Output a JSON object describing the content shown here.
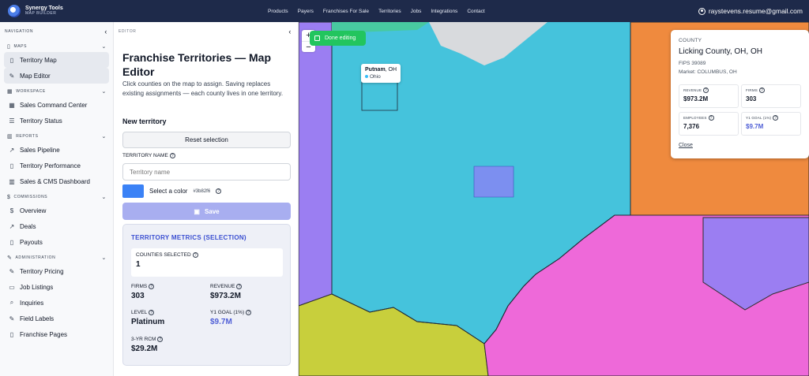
{
  "brand": {
    "name": "Synergy Tools",
    "sub": "MAP BUILDER"
  },
  "topnav": [
    "Products",
    "Payers",
    "Franchises For Sale",
    "Territories",
    "Jobs",
    "Integrations",
    "Contact"
  ],
  "user": {
    "email": "raystevens.resume@gmail.com"
  },
  "sidebar": {
    "header": "NAVIGATION",
    "sections": [
      {
        "title": "MAPS",
        "items": [
          "Territory Map",
          "Map Editor"
        ]
      },
      {
        "title": "WORKSPACE",
        "items": [
          "Sales Command Center",
          "Territory Status"
        ]
      },
      {
        "title": "REPORTS",
        "items": [
          "Sales Pipeline",
          "Territory Performance",
          "Sales & CMS Dashboard"
        ]
      },
      {
        "title": "COMMISSIONS",
        "items": [
          "Overview",
          "Deals",
          "Payouts"
        ]
      },
      {
        "title": "ADMINISTRATION",
        "items": [
          "Territory Pricing",
          "Job Listings",
          "Inquiries",
          "Field Labels",
          "Franchise Pages"
        ]
      }
    ]
  },
  "editor": {
    "header": "EDITOR",
    "title": "Franchise Territories — Map Editor",
    "description": "Click counties on the map to assign. Saving replaces existing assignments — each county lives in one territory.",
    "new_territory": "New territory",
    "reset_label": "Reset selection",
    "name_label": "TERRITORY NAME",
    "name_placeholder": "Territory name",
    "color_label": "Select a color",
    "color_hex": "#3b82f6",
    "save_label": "Save"
  },
  "metrics": {
    "title": "TERRITORY METRICS (SELECTION)",
    "counties_label": "COUNTIES SELECTED",
    "counties_value": "1",
    "firms_label": "FIRMS",
    "firms_value": "303",
    "revenue_label": "REVENUE",
    "revenue_value": "$973.2M",
    "level_label": "LEVEL",
    "level_value": "Platinum",
    "goal_label": "Y1 GOAL (1%)",
    "goal_value": "$9.7M",
    "rcm_label": "3-YR RCM",
    "rcm_value": "$29.2M"
  },
  "map": {
    "done_label": "Done editing",
    "tooltip": {
      "county": "Putnam",
      "state_suffix": ", OH",
      "state": "Ohio"
    },
    "info": {
      "kicker": "COUNTY",
      "name": "Licking County, OH, OH",
      "fips": "FIPS 39089",
      "market": "Market: COLUMBUS, OH",
      "revenue_label": "REVENUE",
      "revenue_value": "$973.2M",
      "firms_label": "FIRMS",
      "firms_value": "303",
      "employees_label": "EMPLOYEES",
      "employees_value": "7,376",
      "goal_label": "Y1 GOAL (1%)",
      "goal_value": "$9.7M",
      "close_label": "Close"
    },
    "colors": {
      "ohio": "#45c3dc",
      "pennsylvania": "#ef8a3e",
      "indiana": "#9b7ef2",
      "kentucky": "#c8cf3c",
      "west_virginia": "#ee69d9",
      "selected": "#7c8ff0"
    }
  }
}
